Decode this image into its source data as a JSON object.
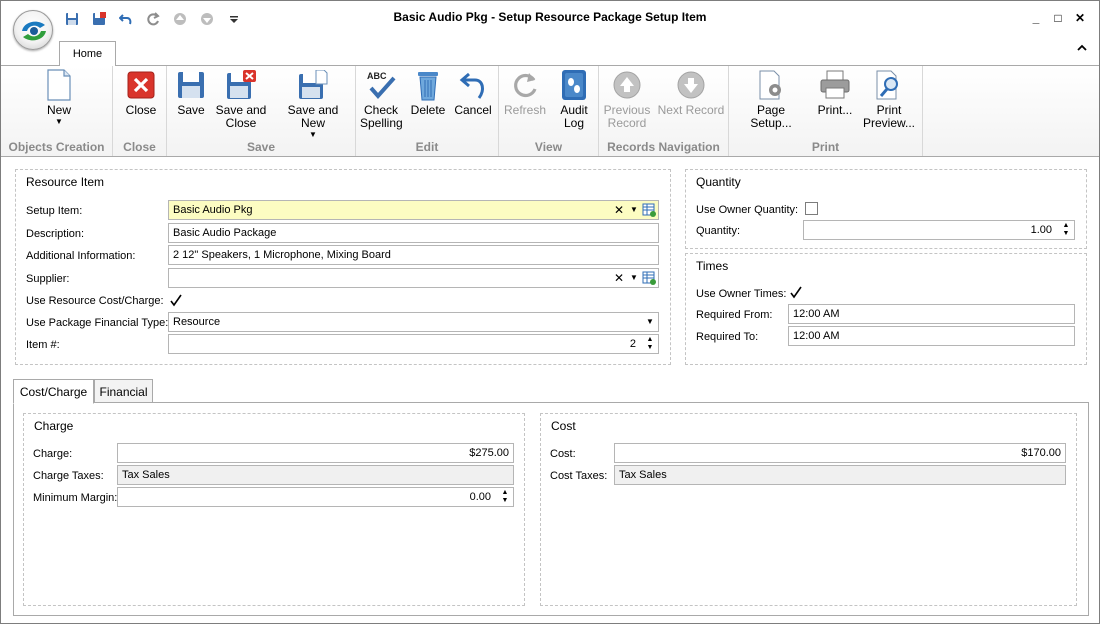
{
  "window": {
    "title": "Basic Audio Pkg - Setup Resource Package Setup Item",
    "controls": {
      "minimize": "_",
      "maximize": "□",
      "close": "✕"
    }
  },
  "quick_access": [
    "save-icon",
    "save-and-close-icon",
    "undo-icon",
    "redo-icon",
    "previous-icon",
    "next-icon",
    "customize-dropdown-icon"
  ],
  "ribbon": {
    "tab": "Home",
    "collapse_glyph": "^",
    "groups": {
      "objects_creation": "Objects Creation",
      "close": "Close",
      "save": "Save",
      "edit": "Edit",
      "view": "View",
      "records_navigation": "Records Navigation",
      "print": "Print"
    },
    "buttons": {
      "new": "New",
      "close": "Close",
      "save": "Save",
      "save_and_close_1": "Save and",
      "save_and_close_2": "Close",
      "save_and_new": "Save and New",
      "check_spelling_1": "Check",
      "check_spelling_2": "Spelling",
      "delete": "Delete",
      "cancel": "Cancel",
      "refresh": "Refresh",
      "audit_log_1": "Audit",
      "audit_log_2": "Log",
      "previous_record_1": "Previous",
      "previous_record_2": "Record",
      "next_record": "Next Record",
      "page_setup": "Page Setup...",
      "print": "Print...",
      "print_preview_1": "Print",
      "print_preview_2": "Preview..."
    },
    "spell_icon_text": "ABC"
  },
  "resource_item": {
    "title": "Resource Item",
    "setup_item_label": "Setup Item:",
    "setup_item_value": "Basic Audio Pkg",
    "description_label": "Description:",
    "description_value": "Basic Audio Package",
    "additional_info_label": "Additional Information:",
    "additional_info_value": "2 12\" Speakers, 1 Microphone, Mixing Board",
    "supplier_label": "Supplier:",
    "supplier_value": "",
    "use_resource_cost_label": "Use Resource Cost/Charge:",
    "use_resource_cost_checked": true,
    "use_package_financial_type_label": "Use Package Financial Type:",
    "use_package_financial_type_value": "Resource",
    "item_no_label": "Item #:",
    "item_no_value": "2"
  },
  "quantity": {
    "title": "Quantity",
    "use_owner_quantity_label": "Use Owner Quantity:",
    "use_owner_quantity_checked": false,
    "quantity_label": "Quantity:",
    "quantity_value": "1.00"
  },
  "times": {
    "title": "Times",
    "use_owner_times_label": "Use Owner Times:",
    "use_owner_times_checked": true,
    "required_from_label": "Required From:",
    "required_from_value": "12:00 AM",
    "required_to_label": "Required To:",
    "required_to_value": "12:00 AM"
  },
  "tabs": [
    "Cost/Charge",
    "Financial"
  ],
  "charge": {
    "title": "Charge",
    "charge_label": "Charge:",
    "charge_value": "$275.00",
    "charge_taxes_label": "Charge Taxes:",
    "charge_taxes_value": "Tax Sales",
    "minimum_margin_label": "Minimum Margin:",
    "minimum_margin_value": "0.00"
  },
  "cost": {
    "title": "Cost",
    "cost_label": "Cost:",
    "cost_value": "$170.00",
    "cost_taxes_label": "Cost Taxes:",
    "cost_taxes_value": "Tax Sales"
  },
  "glyphs": {
    "clear": "✕",
    "dropdown": "▼",
    "spin_up": "▲",
    "spin_down": "▼",
    "check": "✓"
  },
  "colors": {
    "highlight_field": "#fcfcc2",
    "group_label": "#8a8a8a",
    "close_red": "#d9342b"
  }
}
